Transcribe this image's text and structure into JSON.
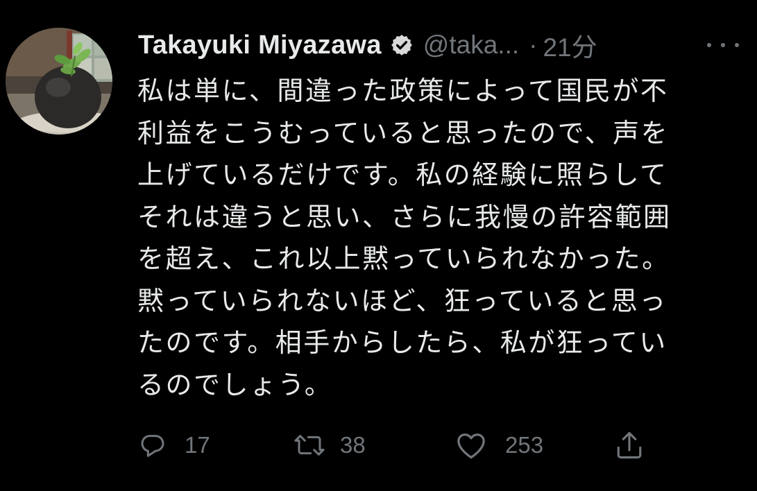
{
  "tweet": {
    "display_name": "Takayuki Miyazawa",
    "handle": "@taka...",
    "separator": "·",
    "time": "21分",
    "text": "私は単に、間違った政策によって国民が不\n利益をこうむっていると思ったので、声を\n上げているだけです。私の経験に照らして\nそれは違うと思い、さらに我慢の許容範囲\nを超え、これ以上黙っていられなかった。\n黙っていられないほど、狂っていると思っ\nたのです。相手からしたら、私が狂ってい\nるのでしょう。",
    "actions": {
      "reply_count": "17",
      "retweet_count": "38",
      "like_count": "253"
    }
  },
  "icons": {
    "verified": "verified-badge-icon",
    "more": "more-options-icon",
    "reply": "reply-icon",
    "retweet": "retweet-icon",
    "like": "heart-icon",
    "share": "share-icon"
  },
  "colors": {
    "background": "#000000",
    "text_primary": "#e7e9ea",
    "text_secondary": "#71767b"
  }
}
